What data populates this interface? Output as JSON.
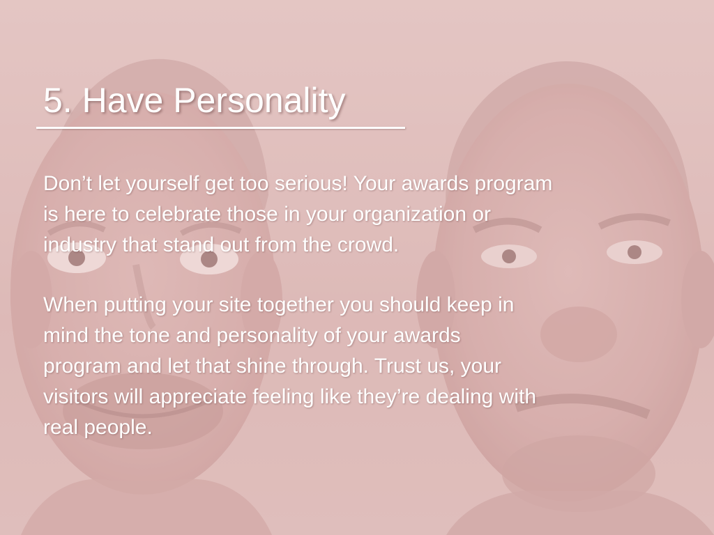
{
  "slide": {
    "title": "5. Have Personality",
    "paragraph1_lines": [
      "Don’t let yourself get too serious! Your awards program",
      "is here to celebrate those in your organization or",
      "industry that stand out from the crowd."
    ],
    "paragraph2_lines": [
      "When putting your site together you should keep in",
      "mind the tone and personality of your awards",
      "program and let that shine through. Trust us, your",
      "visitors will appreciate feeling like they’re dealing with",
      "real people."
    ]
  },
  "colors": {
    "background_tint": "#dcbab8",
    "text": "#ffffff"
  }
}
